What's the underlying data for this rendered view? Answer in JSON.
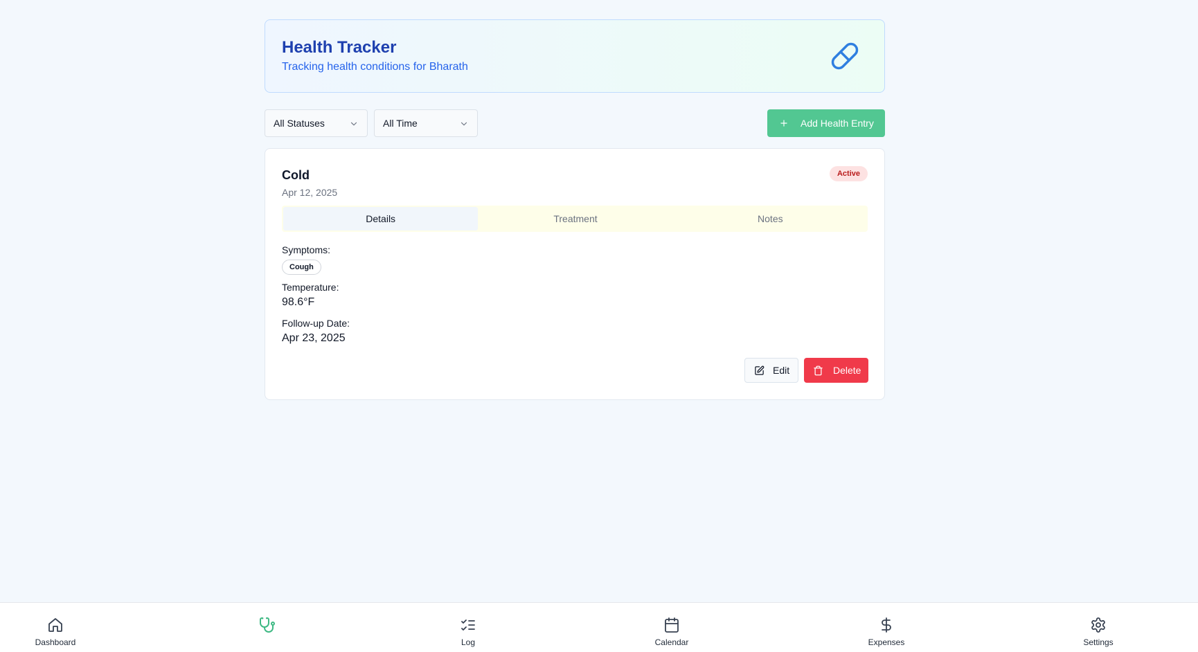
{
  "header": {
    "title": "Health Tracker",
    "subtitle": "Tracking health conditions for Bharath",
    "icon": "pill-icon"
  },
  "filters": {
    "status": {
      "selected": "All Statuses",
      "icon": "chevron-down-icon"
    },
    "time": {
      "selected": "All Time",
      "icon": "chevron-down-icon"
    }
  },
  "actions": {
    "add_label": "Add Health Entry",
    "add_icon": "plus-icon"
  },
  "entry": {
    "title": "Cold",
    "date": "Apr 12, 2025",
    "status": "Active",
    "tabs": [
      {
        "label": "Details",
        "active": true
      },
      {
        "label": "Treatment",
        "active": false
      },
      {
        "label": "Notes",
        "active": false
      }
    ],
    "symptoms_label": "Symptoms:",
    "symptoms": [
      "Cough"
    ],
    "temperature_label": "Temperature:",
    "temperature": "98.6°F",
    "followup_label": "Follow-up Date:",
    "followup": "Apr 23, 2025",
    "edit_label": "Edit",
    "delete_label": "Delete"
  },
  "nav": {
    "items": [
      {
        "label": "Dashboard",
        "icon": "home-icon"
      },
      {
        "label": "",
        "icon": "stethoscope-icon",
        "active": true
      },
      {
        "label": "Log",
        "icon": "list-checks-icon"
      },
      {
        "label": "Calendar",
        "icon": "calendar-icon"
      },
      {
        "label": "Expenses",
        "icon": "dollar-icon"
      },
      {
        "label": "Settings",
        "icon": "gear-icon"
      }
    ]
  },
  "colors": {
    "primary_blue": "#1e40af",
    "accent_green": "#52c792",
    "danger_red": "#f03a4a",
    "active_badge_bg": "#fde2e2",
    "active_badge_text": "#b91c1c"
  }
}
